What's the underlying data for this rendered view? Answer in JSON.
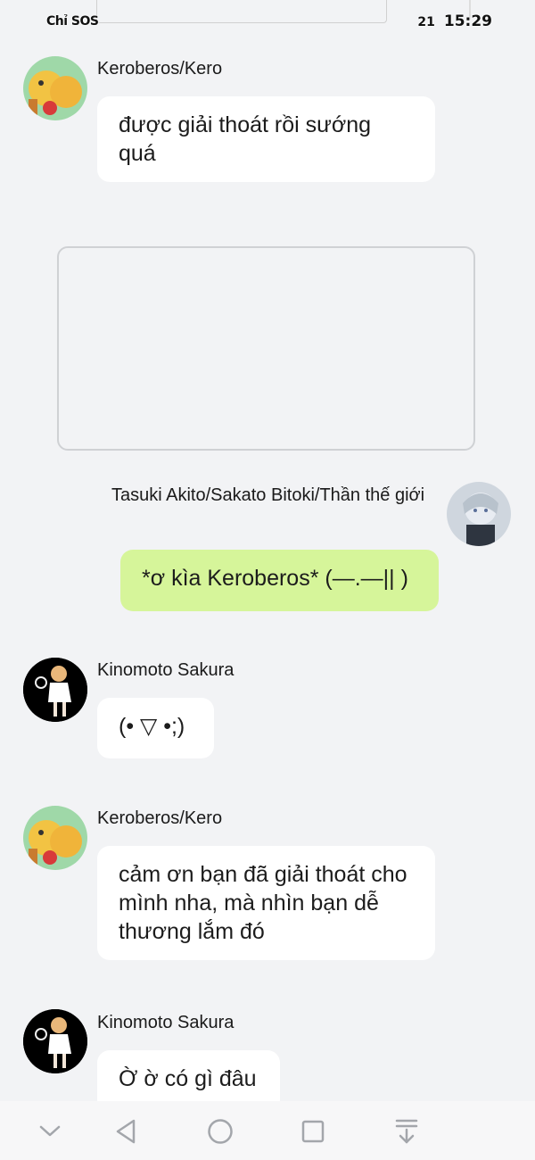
{
  "status": {
    "carrier": "Chỉ SOS",
    "battery": "21",
    "time": "15:29"
  },
  "messages": [
    {
      "sender": "Keroberos/Kero",
      "text": "được giải thoát rồi sướng quá",
      "avatar_icon": "kero-avatar"
    },
    {
      "sender": "Tasuki Akito/Sakato Bitoki/Thần thế giới",
      "text": "*ơ kìa Keroberos* (—.—|| )",
      "avatar_icon": "akito-avatar"
    },
    {
      "sender": "Kinomoto Sakura",
      "text": "(• ▽ •;)",
      "avatar_icon": "sakura-avatar"
    },
    {
      "sender": "Keroberos/Kero",
      "text": "cảm ơn bạn đã giải thoát cho mình nha, mà nhìn bạn dễ thương lắm đó",
      "avatar_icon": "kero-avatar"
    },
    {
      "sender": "Kinomoto Sakura",
      "text": "Ờ ờ có gì đâu",
      "avatar_icon": "sakura-avatar"
    }
  ],
  "colors": {
    "background": "#f2f3f5",
    "bubble_other": "#ffffff",
    "bubble_mine": "#d6f59a"
  },
  "navbar": {
    "icons": [
      "chevron-down-icon",
      "back-icon",
      "home-icon",
      "recents-icon",
      "download-icon"
    ]
  }
}
